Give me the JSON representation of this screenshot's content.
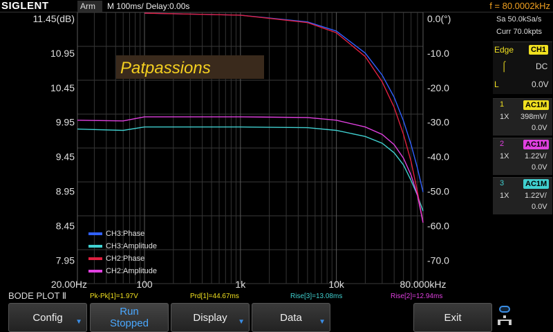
{
  "header": {
    "brand": "SIGLENT",
    "trigger_status": "Arm",
    "timebase": "M 100ms/  Delay:0.00s",
    "frequency": "f = 80.0002kHz"
  },
  "right_panel": {
    "sample_rate": "Sa 50.0kSa/s",
    "memory": "Curr 70.0kpts",
    "trigger": {
      "label": "Edge",
      "source": "CH1",
      "coupling": "DC",
      "level_label": "L",
      "level": "0.0V"
    },
    "channels": [
      {
        "num": "1",
        "coupling": "AC1M",
        "probe": "1X",
        "scale": "398mV/",
        "offset": "0.0V",
        "color": "#f0e020"
      },
      {
        "num": "2",
        "coupling": "AC1M",
        "probe": "1X",
        "scale": "1.22V/",
        "offset": "0.0V",
        "color": "#e040e0"
      },
      {
        "num": "3",
        "coupling": "AC1M",
        "probe": "1X",
        "scale": "1.22V/",
        "offset": "0.0V",
        "color": "#40d0d0"
      }
    ]
  },
  "status": {
    "mode": "BODE PLOT Ⅱ",
    "pkpk": "Pk-Pk[1]=1.97V",
    "prd": "Prd[1]=44.67ms",
    "rise3": "Rise[3]=13.08ms",
    "rise2": "Rise[2]=12.94ms"
  },
  "softkeys": {
    "config": "Config",
    "run_line1": "Run",
    "run_line2": "Stopped",
    "display": "Display",
    "data": "Data",
    "exit": "Exit"
  },
  "watermark": "Patpassions",
  "chart_data": {
    "type": "line",
    "x_scale": "log",
    "xlim": [
      20,
      80000
    ],
    "x_ticks": [
      "20.00Hz",
      "100",
      "1k",
      "10k",
      "80.000kHz"
    ],
    "y_left_label": "11.45(dB)",
    "y_left_ticks": [
      "10.95",
      "10.45",
      "9.95",
      "9.45",
      "8.95",
      "8.45",
      "7.95"
    ],
    "y_left_lim": [
      7.45,
      11.45
    ],
    "y_right_label": "0.0(°)",
    "y_right_ticks": [
      "-10.0",
      "-20.0",
      "-30.0",
      "-40.0",
      "-50.0",
      "-60.0",
      "-70.0"
    ],
    "y_right_lim": [
      -80,
      0
    ],
    "grid": true,
    "legend_position": "bottom-left",
    "series": [
      {
        "name": "CH3:Phase",
        "color": "#3060ff",
        "axis": "right",
        "x": [
          100,
          1000,
          5000,
          10000,
          20000,
          30000,
          40000,
          50000,
          60000,
          70000,
          80000
        ],
        "y": [
          -0.2,
          -0.8,
          -2.8,
          -5.5,
          -12,
          -18.5,
          -25,
          -32,
          -39,
          -46,
          -53
        ]
      },
      {
        "name": "CH3:Amplitude",
        "color": "#40d0d0",
        "axis": "left",
        "x": [
          20,
          60,
          100,
          1000,
          5000,
          10000,
          20000,
          30000,
          40000,
          50000,
          60000,
          70000,
          80000
        ],
        "y": [
          9.73,
          9.71,
          9.76,
          9.76,
          9.75,
          9.71,
          9.62,
          9.52,
          9.38,
          9.2,
          8.97,
          8.75,
          8.52
        ]
      },
      {
        "name": "CH2:Phase",
        "color": "#e02040",
        "axis": "right",
        "x": [
          100,
          1000,
          5000,
          10000,
          20000,
          30000,
          40000,
          50000,
          60000,
          70000,
          80000
        ],
        "y": [
          -0.2,
          -0.8,
          -3,
          -6,
          -13,
          -20.5,
          -28,
          -36,
          -44,
          -53,
          -62
        ]
      },
      {
        "name": "CH2:Amplitude",
        "color": "#e040e0",
        "axis": "left",
        "x": [
          20,
          60,
          100,
          1000,
          5000,
          10000,
          20000,
          30000,
          40000,
          50000,
          60000,
          70000,
          80000
        ],
        "y": [
          9.86,
          9.85,
          9.91,
          9.91,
          9.9,
          9.86,
          9.76,
          9.65,
          9.5,
          9.3,
          9.05,
          8.75,
          8.35
        ]
      }
    ]
  }
}
